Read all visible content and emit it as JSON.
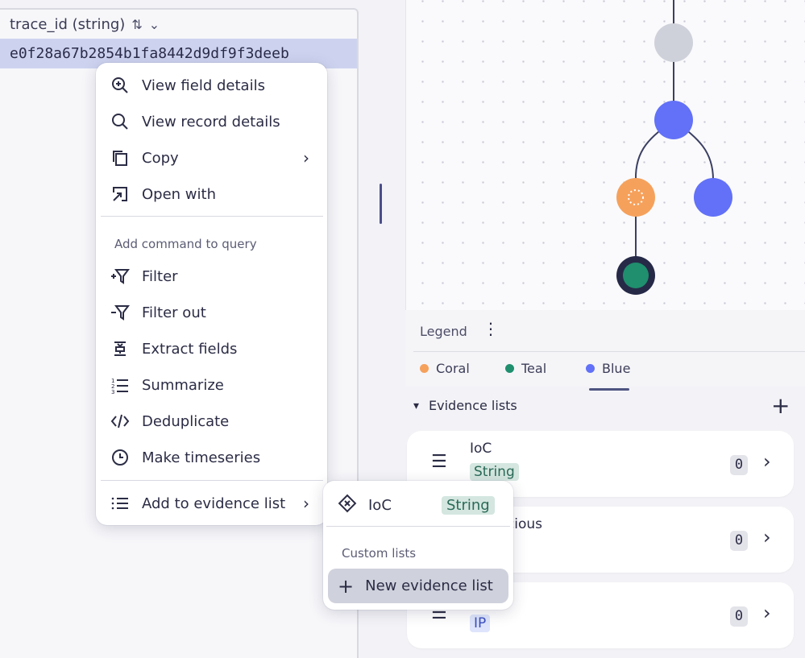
{
  "table": {
    "column_header": "trace_id (string)",
    "selected_value": "e0f28a67b2854b1fa8442d9df9f3deeb"
  },
  "context_menu": {
    "items": [
      {
        "label": "View field details",
        "icon": "zoom-in-icon"
      },
      {
        "label": "View record details",
        "icon": "search-icon"
      },
      {
        "label": "Copy",
        "icon": "copy-icon",
        "has_submenu": true
      },
      {
        "label": "Open with",
        "icon": "open-with-icon"
      }
    ],
    "section_label": "Add command to query",
    "query_items": [
      {
        "label": "Filter",
        "icon": "filter-add-icon"
      },
      {
        "label": "Filter out",
        "icon": "filter-remove-icon"
      },
      {
        "label": "Extract fields",
        "icon": "extract-icon"
      },
      {
        "label": "Summarize",
        "icon": "summarize-icon"
      },
      {
        "label": "Deduplicate",
        "icon": "code-icon"
      },
      {
        "label": "Make timeseries",
        "icon": "clock-icon"
      }
    ],
    "evidence_item": {
      "label": "Add to evidence list",
      "icon": "list-icon",
      "has_submenu": true
    }
  },
  "submenu": {
    "ioc_label": "IoC",
    "ioc_tag": "String",
    "section_label": "Custom lists",
    "new_list_label": "New evidence list"
  },
  "legend": {
    "title": "Legend",
    "items": [
      {
        "label": "Coral",
        "color": "#f5a15c"
      },
      {
        "label": "Teal",
        "color": "#1f8f6e"
      },
      {
        "label": "Blue",
        "color": "#6271f7"
      }
    ]
  },
  "evidence_lists": {
    "title": "Evidence lists",
    "cards": [
      {
        "name": "IoC",
        "tag": "String",
        "count": "0",
        "tag_bg": "#d4e6df",
        "tag_fg": "#2a6a57"
      },
      {
        "name": "Suspicious",
        "tag": "",
        "count": "0"
      },
      {
        "name": "",
        "tag": "IP",
        "count": "0",
        "tag_bg": "#dde4fb",
        "tag_fg": "#3b4fc0"
      }
    ]
  },
  "colors": {
    "accent": "#6271f7",
    "coral": "#f5a15c",
    "teal": "#1f8f6e",
    "gray_node": "#cfd1da",
    "selection": "#cdd3ef"
  }
}
